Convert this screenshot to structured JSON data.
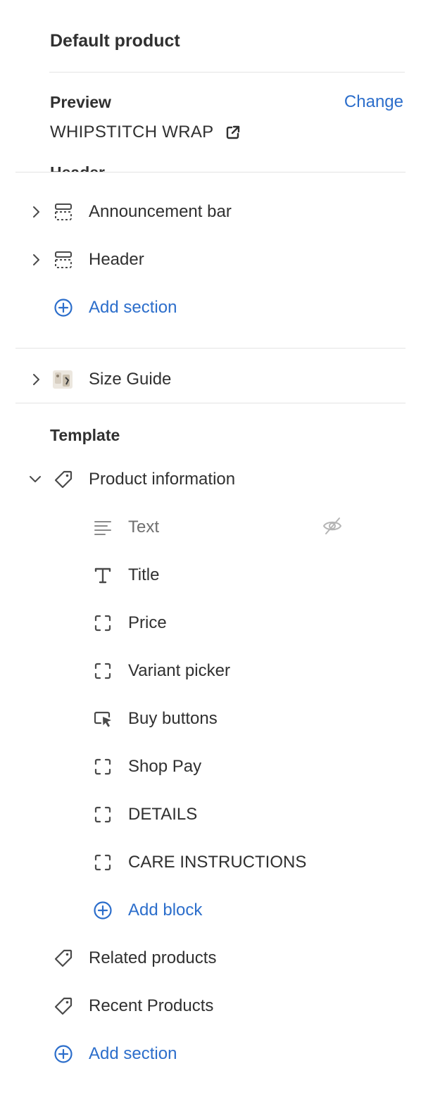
{
  "panel": {
    "title": "Default product"
  },
  "preview": {
    "label": "Preview",
    "change_label": "Change",
    "product_name": "WHIPSTITCH WRAP",
    "open_icon": "external-link-icon"
  },
  "header_group": {
    "label": "Header",
    "sections": [
      {
        "label": "Announcement bar",
        "icon": "section-layout-icon"
      },
      {
        "label": "Header",
        "icon": "section-layout-icon"
      }
    ],
    "add_label": "Add section"
  },
  "app_section": {
    "label": "Size Guide",
    "icon": "app-thumbnail-icon"
  },
  "template": {
    "label": "Template",
    "product_info": {
      "label": "Product information",
      "icon": "tag-icon",
      "blocks": [
        {
          "label": "Text",
          "icon": "text-lines-icon",
          "hidden": true
        },
        {
          "label": "Title",
          "icon": "title-t-icon"
        },
        {
          "label": "Price",
          "icon": "block-dashed-icon"
        },
        {
          "label": "Variant picker",
          "icon": "block-dashed-icon"
        },
        {
          "label": "Buy buttons",
          "icon": "cursor-button-icon"
        },
        {
          "label": "Shop Pay",
          "icon": "block-dashed-icon"
        },
        {
          "label": "DETAILS",
          "icon": "block-dashed-icon"
        },
        {
          "label": "CARE INSTRUCTIONS",
          "icon": "block-dashed-icon"
        }
      ],
      "add_block_label": "Add block"
    },
    "sections": [
      {
        "label": "Related products",
        "icon": "tag-icon"
      },
      {
        "label": "Recent Products",
        "icon": "tag-icon"
      }
    ],
    "add_label": "Add section"
  },
  "colors": {
    "accent": "#2c6ecb",
    "text": "#303030",
    "muted": "#6f6f6f",
    "divider": "#e3e3e3"
  }
}
